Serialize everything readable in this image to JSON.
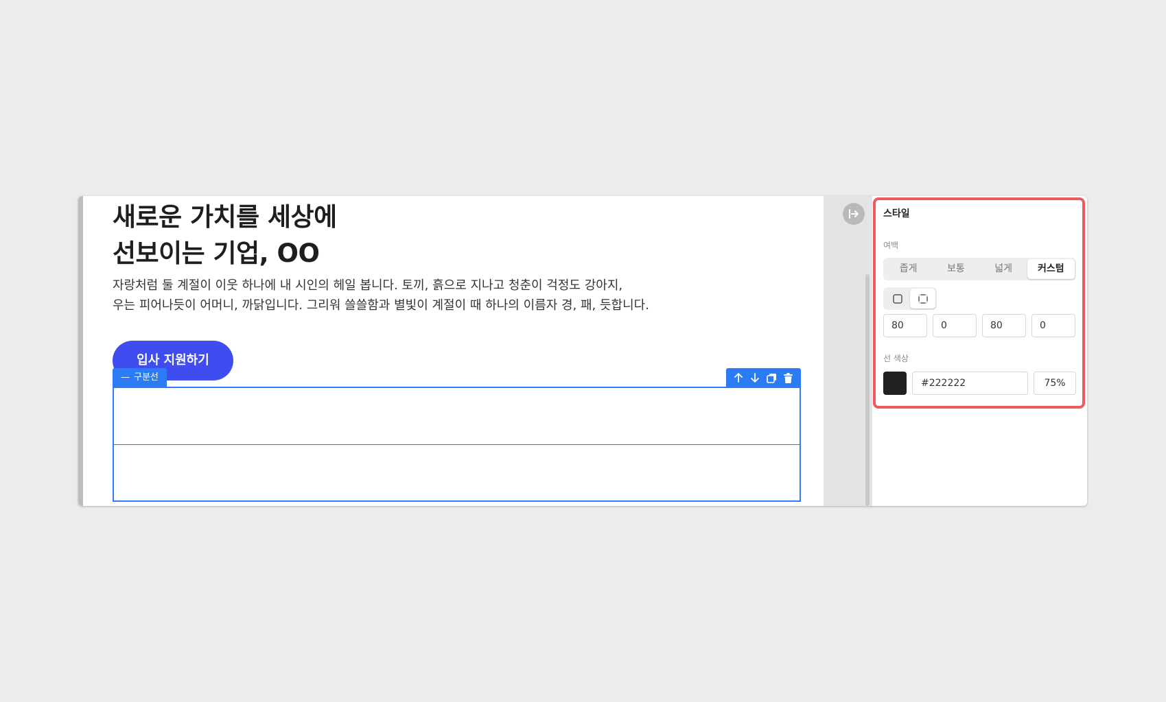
{
  "canvas": {
    "headline": [
      "새로운 가치를 세상에",
      "선보이는 기업, OO"
    ],
    "body": [
      "자랑처럼 둘 계절이 이웃 하나에 내 시인의 헤일 봅니다. 토끼, 흙으로 지나고 청춘이 걱정도 강아지,",
      "우는 피어나듯이 어머니, 까닭입니다. 그리워 쓸쓸함과 별빛이 계절이 때 하나의 이름자 경, 패, 듯합니다."
    ],
    "button_label": "입사 지원하기",
    "button_color": "#3f4cf0",
    "block": {
      "tag_icon": "—",
      "tag_label": "구분선",
      "selection_color": "#2a7bf5",
      "toolbar": [
        "arrow-up-icon",
        "arrow-down-icon",
        "duplicate-icon",
        "trash-icon"
      ]
    }
  },
  "gutter": {
    "collapse_icon": "collapse-panel-icon"
  },
  "panel": {
    "title": "스타일",
    "spacing_label": "여백",
    "spacing_options": [
      "좁게",
      "보통",
      "넓게",
      "커스텀"
    ],
    "spacing_selected": "커스텀",
    "padding_modes": [
      "all-sides-icon",
      "individual-sides-icon"
    ],
    "padding_mode_selected": "individual-sides-icon",
    "padding_values": [
      "80",
      "0",
      "80",
      "0"
    ],
    "line_color_label": "선 색상",
    "line_color_hex": "#222222",
    "line_opacity": "75%",
    "highlight_color": "#ef5a5f"
  }
}
